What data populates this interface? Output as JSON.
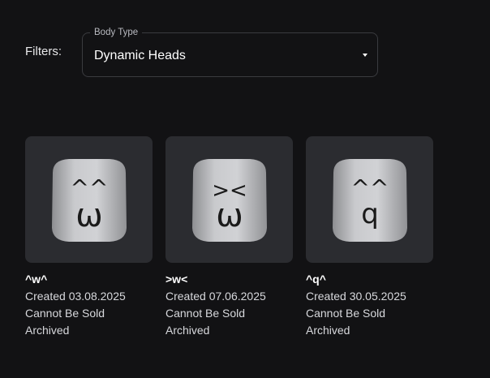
{
  "filters": {
    "label": "Filters:",
    "body_type": {
      "legend": "Body Type",
      "selected": "Dynamic Heads"
    }
  },
  "items": [
    {
      "name": "^w^",
      "created": "Created 03.08.2025",
      "sale_status": "Cannot Be Sold",
      "archive_status": "Archived",
      "face_eyes": "^^",
      "face_mouth": "ω",
      "icon": "head-icon"
    },
    {
      "name": ">w<",
      "created": "Created 07.06.2025",
      "sale_status": "Cannot Be Sold",
      "archive_status": "Archived",
      "face_eyes": "><",
      "face_mouth": "ω",
      "icon": "head-icon"
    },
    {
      "name": "^q^",
      "created": "Created 30.05.2025",
      "sale_status": "Cannot Be Sold",
      "archive_status": "Archived",
      "face_eyes": "^^",
      "face_mouth": "q",
      "icon": "head-icon"
    }
  ]
}
